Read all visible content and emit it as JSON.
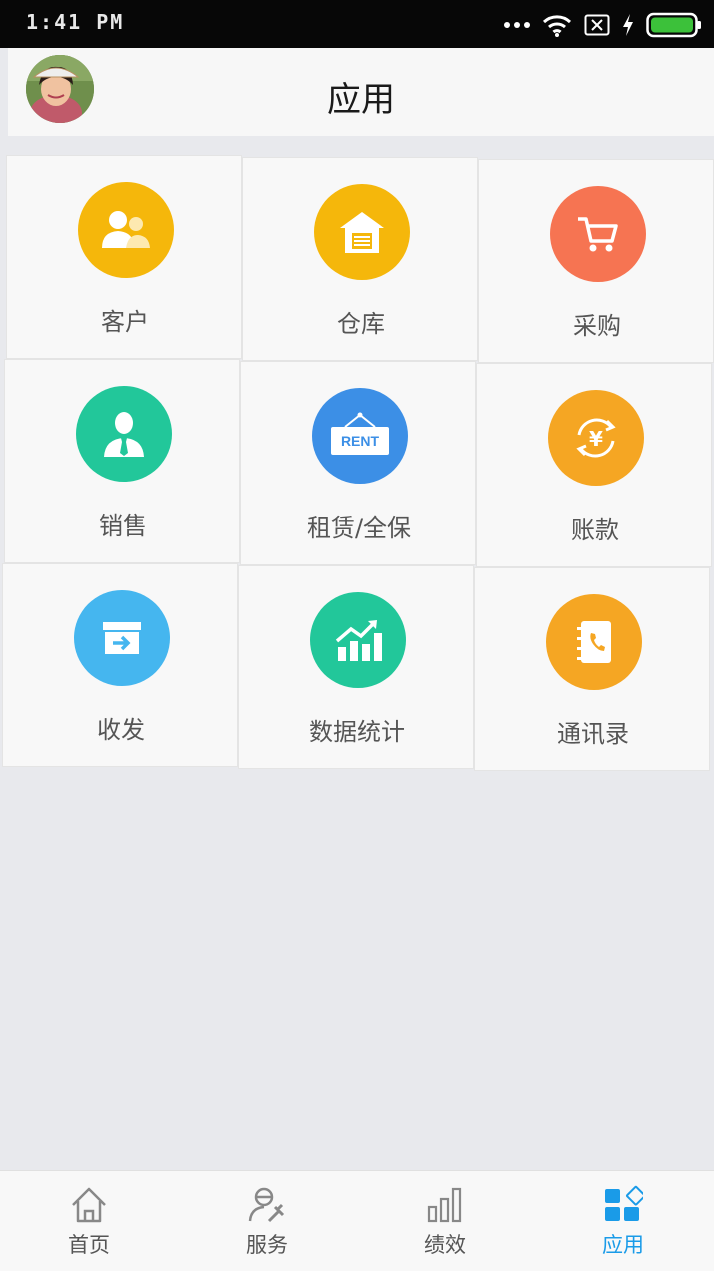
{
  "status_bar": {
    "time": "1:41 PM",
    "colors": {
      "battery": "#3cc13a"
    }
  },
  "header": {
    "title": "应用"
  },
  "apps": [
    {
      "label": "客户",
      "icon": "customers-icon",
      "color": "#f5b70b"
    },
    {
      "label": "仓库",
      "icon": "warehouse-icon",
      "color": "#f5b70b"
    },
    {
      "label": "采购",
      "icon": "cart-icon",
      "color": "#f67452"
    },
    {
      "label": "销售",
      "icon": "salesperson-icon",
      "color": "#22c79a"
    },
    {
      "label": "租赁/全保",
      "icon": "rent-sign-icon",
      "color": "#3c8fe6"
    },
    {
      "label": "账款",
      "icon": "yuan-refresh-icon",
      "color": "#f5a623"
    },
    {
      "label": "收发",
      "icon": "inbox-arrow-icon",
      "color": "#45b6ef"
    },
    {
      "label": "数据统计",
      "icon": "chart-up-icon",
      "color": "#22c79a"
    },
    {
      "label": "通讯录",
      "icon": "contacts-book-icon",
      "color": "#f5a623"
    }
  ],
  "tabbar": [
    {
      "label": "首页",
      "icon": "home-icon"
    },
    {
      "label": "服务",
      "icon": "service-icon"
    },
    {
      "label": "绩效",
      "icon": "performance-icon"
    },
    {
      "label": "应用",
      "icon": "apps-icon",
      "active": true,
      "active_color": "#1a9be8"
    }
  ]
}
